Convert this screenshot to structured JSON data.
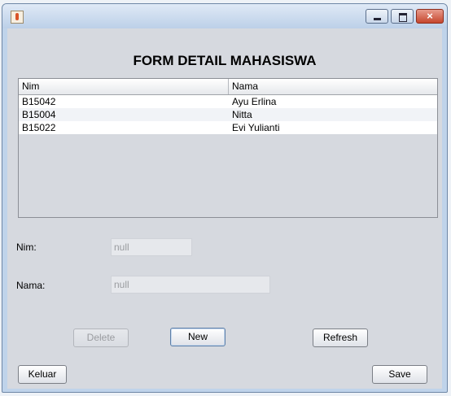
{
  "window": {
    "title": "",
    "controls": {
      "minimize": "",
      "maximize": "",
      "close": "×"
    }
  },
  "form": {
    "title": "FORM DETAIL MAHASISWA"
  },
  "table": {
    "columns": [
      "Nim",
      "Nama"
    ],
    "rows": [
      [
        "B15042",
        "Ayu Erlina"
      ],
      [
        "B15004",
        "Nitta"
      ],
      [
        "B15022",
        "Evi Yulianti"
      ]
    ]
  },
  "fields": {
    "nim": {
      "label": "Nim:",
      "value": "null"
    },
    "nama": {
      "label": "Nama:",
      "value": "null"
    }
  },
  "buttons": {
    "delete": "Delete",
    "new": "New",
    "refresh": "Refresh",
    "keluar": "Keluar",
    "save": "Save"
  }
}
